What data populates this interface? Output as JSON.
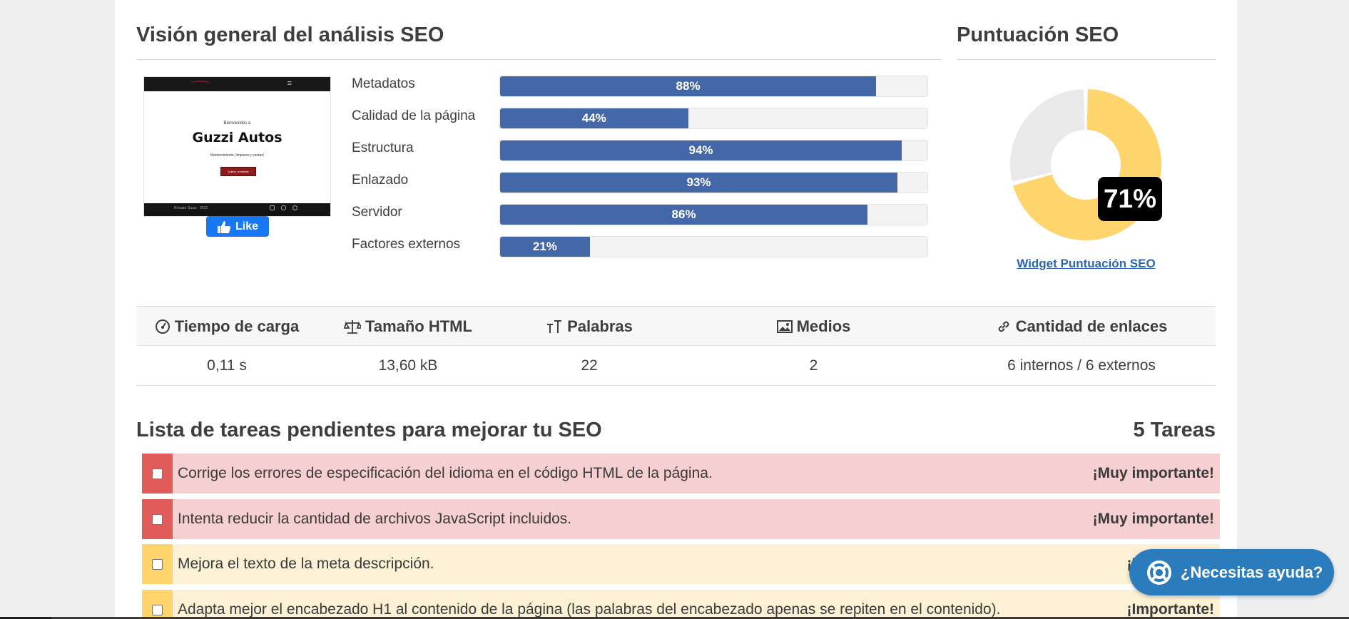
{
  "overview": {
    "title": "Visión general del análisis SEO",
    "thumbnail": {
      "subtitle": "Bienvenidos a",
      "site_name": "Guzzi Autos",
      "tagline": "Mantenimiento, limpieza y ventas!",
      "button": "Quiero contactar",
      "footer": "Rosado Guzzi · 2022"
    },
    "like_label": "Like",
    "bars": [
      {
        "label": "Metadatos",
        "value": 88,
        "text": "88%"
      },
      {
        "label": "Calidad de la página",
        "value": 44,
        "text": "44%"
      },
      {
        "label": "Estructura",
        "value": 94,
        "text": "94%"
      },
      {
        "label": "Enlazado",
        "value": 93,
        "text": "93%"
      },
      {
        "label": "Servidor",
        "value": 86,
        "text": "86%"
      },
      {
        "label": "Factores externos",
        "value": 21,
        "text": "21%"
      }
    ]
  },
  "score": {
    "title": "Puntuación SEO",
    "value": 71,
    "text": "71%",
    "link": "Widget Puntuación SEO",
    "colors": {
      "filled": "#fdd56c",
      "empty": "#e9e9e9"
    }
  },
  "stats": {
    "headers": [
      "Tiempo de carga",
      "Tamaño HTML",
      "Palabras",
      "Medios",
      "Cantidad de enlaces"
    ],
    "icons": [
      "speedometer-icon",
      "scale-icon",
      "text-size-icon",
      "image-icon",
      "link-icon"
    ],
    "values": [
      "0,11 s",
      "13,60 kB",
      "22",
      "2",
      "6 internos / 6 externos"
    ]
  },
  "tasks": {
    "title": "Lista de tareas pendientes para mejorar tu SEO",
    "count": "5 Tareas",
    "items": [
      {
        "text": "Corrige los errores de especificación del idioma en el código HTML de la página.",
        "importance": "¡Muy importante!",
        "level": "red"
      },
      {
        "text": "Intenta reducir la cantidad de archivos JavaScript incluidos.",
        "importance": "¡Muy importante!",
        "level": "red"
      },
      {
        "text": "Mejora el texto de la meta descripción.",
        "importance": "¡Importante!",
        "level": "yellow"
      },
      {
        "text": "Adapta mejor el encabezado H1 al contenido de la página (las palabras del encabezado apenas se repiten en el contenido).",
        "importance": "¡Importante!",
        "level": "yellow"
      }
    ]
  },
  "help": {
    "label": "¿Necesitas ayuda?"
  }
}
